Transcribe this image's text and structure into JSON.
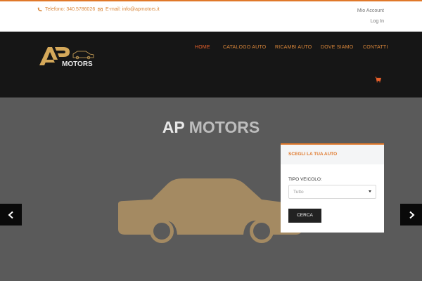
{
  "topbar": {
    "phone": "Telefono: 340.5786026",
    "email": "E-mail: info@apmotors.it",
    "account": "Mio Account",
    "login": "Log In"
  },
  "navbar": {
    "logo_text": "MOTORS",
    "items": [
      {
        "label": "HOME"
      },
      {
        "label": "CATALOGO AUTO"
      },
      {
        "label": "RICAMBI AUTO"
      },
      {
        "label": "DOVE SIAMO"
      },
      {
        "label": "CONTATTI"
      }
    ],
    "active_item": "HOME",
    "cart_icon": "cart-icon"
  },
  "hero": {
    "title_part1": "AP",
    "title_part2": "MOTORS",
    "prev_icon": "chevron-left-icon",
    "next_icon": "chevron-right-icon"
  },
  "search": {
    "title": "SCEGLI LA TUA AUTO",
    "vehicle_label": "TIPO VEICOLO:",
    "vehicle_value": "Tutto",
    "button": "CERCA"
  },
  "colors": {
    "accent": "#e0782a",
    "active_nav": "#e8602a",
    "gold": "#a48a62",
    "navbar_bg": "#161616",
    "hero_bg": "#5a5a5a"
  }
}
